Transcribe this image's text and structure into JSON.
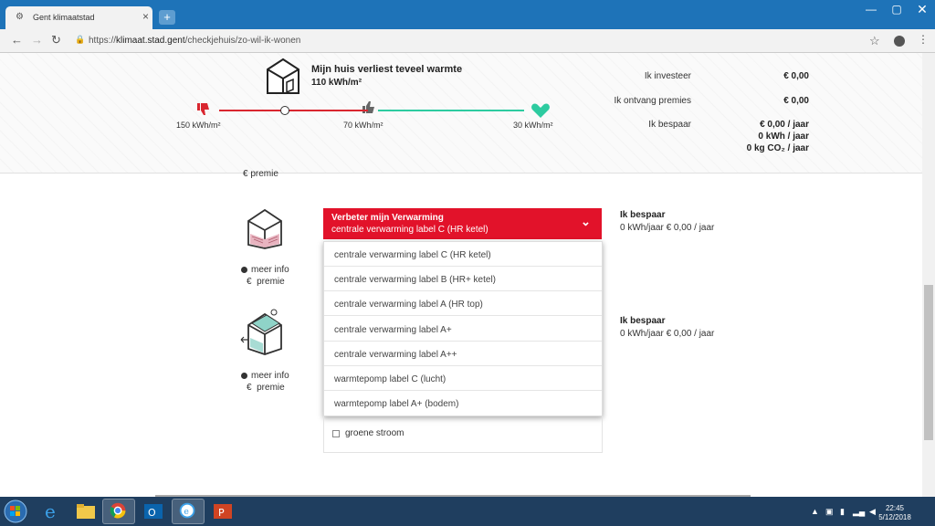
{
  "browser": {
    "tab_title": "Gent klimaatstad",
    "url_prefix": "https://",
    "url_host": "klimaat.stad.gent",
    "url_path": "/checkjehuis/zo-wil-ik-wonen"
  },
  "header": {
    "title": "Mijn huis verliest teveel warmte",
    "value": "110 kWh/m²",
    "scale": [
      "150 kWh/m²",
      "70 kWh/m²",
      "30 kWh/m²"
    ],
    "summary": {
      "invest_label": "Ik investeer",
      "invest_value": "€ 0,00",
      "premie_label": "Ik ontvang premies",
      "premie_value": "€ 0,00",
      "save_label": "Ik bespaar",
      "save_money": "€ 0,00 / jaar",
      "save_kwh": "0 kWh / jaar",
      "save_co2": "0 kg CO₂ / jaar"
    }
  },
  "top_premie": "premie",
  "rows": [
    {
      "info": "meer info",
      "premie": "premie",
      "select_title": "Verbeter mijn Verwarming",
      "select_value": "centrale verwarming label C (HR ketel)",
      "result_title": "Ik bespaar",
      "result_value": "0 kWh/jaar   € 0,00 / jaar"
    },
    {
      "info": "meer info",
      "premie": "premie",
      "result_title": "Ik bespaar",
      "result_value": "0 kWh/jaar   € 0,00 / jaar"
    }
  ],
  "dropdown_options": [
    "centrale verwarming label C (HR ketel)",
    "centrale verwarming label B (HR+ ketel)",
    "centrale verwarming label A (HR top)",
    "centrale verwarming label A+",
    "centrale verwarming label A++",
    "warmtepomp label C (lucht)",
    "warmtepomp label A+ (bodem)"
  ],
  "checkbox_label": "groene stroom",
  "taskbar": {
    "time": "22:45",
    "date": "5/12/2018"
  },
  "colors": {
    "accent_red": "#e2122a",
    "scale_green": "#2dcba0",
    "taskbar": "#1f3e5f",
    "tabbar": "#1e73b8"
  }
}
